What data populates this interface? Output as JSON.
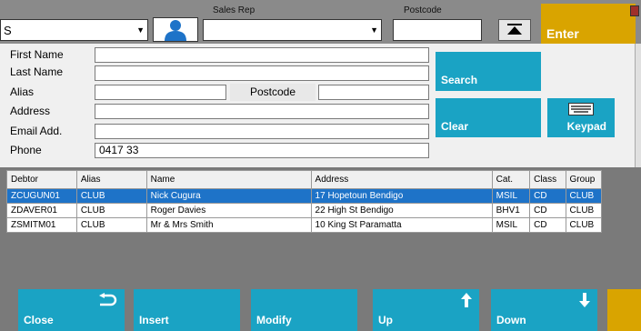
{
  "toolbar": {
    "first_combo_value": "S",
    "sales_rep_label": "Sales Rep",
    "sales_rep_value": "",
    "postcode_label": "Postcode",
    "postcode_value": "",
    "enter_label": "Enter"
  },
  "form": {
    "first_name_label": "First Name",
    "first_name_value": "",
    "last_name_label": "Last Name",
    "last_name_value": "",
    "alias_label": "Alias",
    "alias_value": "",
    "postcode_label": "Postcode",
    "postcode_value": "",
    "address_label": "Address",
    "address_value": "",
    "email_label": "Email Add.",
    "email_value": "",
    "phone_label": "Phone",
    "phone_value": "0417 33"
  },
  "actions": {
    "search_label": "Search",
    "clear_label": "Clear",
    "keypad_label": "Keypad"
  },
  "table": {
    "headers": [
      "Debtor",
      "Alias",
      "Name",
      "Address",
      "Cat.",
      "Class",
      "Group"
    ],
    "rows": [
      {
        "debtor": "ZCUGUN01",
        "alias": "CLUB",
        "name": "Nick Cugura",
        "address": "17 Hopetoun Bendigo",
        "cat": "MSIL",
        "class": "CD",
        "group": "CLUB"
      },
      {
        "debtor": "ZDAVER01",
        "alias": "CLUB",
        "name": "Roger Davies",
        "address": "22 High St Bendigo",
        "cat": "BHV1",
        "class": "CD",
        "group": "CLUB"
      },
      {
        "debtor": "ZSMITM01",
        "alias": "CLUB",
        "name": "Mr & Mrs Smith",
        "address": "10 King St Paramatta",
        "cat": "MSIL",
        "class": "CD",
        "group": "CLUB"
      }
    ]
  },
  "bottom": {
    "close_label": "Close",
    "insert_label": "Insert",
    "modify_label": "Modify",
    "up_label": "Up",
    "down_label": "Down"
  },
  "colors": {
    "tile": "#1aa3c4",
    "enter": "#d9a400",
    "selected_row": "#1e73c8",
    "background": "#7a7a7a"
  }
}
